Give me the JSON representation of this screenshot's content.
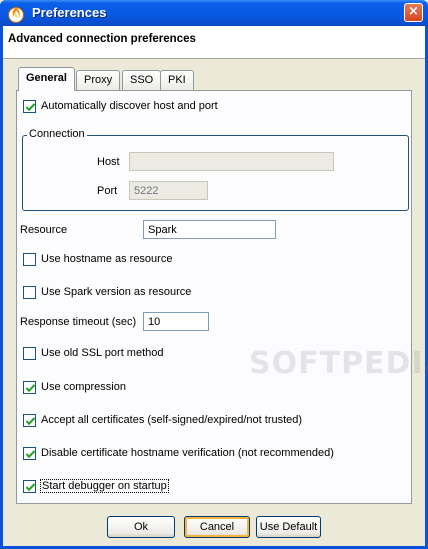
{
  "window": {
    "title": "Preferences",
    "icon": "flame-icon",
    "close_label": "×"
  },
  "header": {
    "title": "Advanced connection preferences"
  },
  "tabs": [
    {
      "label": "General",
      "active": true
    },
    {
      "label": "Proxy",
      "active": false
    },
    {
      "label": "SSO",
      "active": false
    },
    {
      "label": "PKI",
      "active": false
    }
  ],
  "general": {
    "auto_discover": {
      "label": "Automatically discover host and port",
      "checked": true
    },
    "connection": {
      "title": "Connection",
      "host_label": "Host",
      "host_value": "",
      "port_label": "Port",
      "port_placeholder": "5222"
    },
    "resource": {
      "label": "Resource",
      "value": "Spark"
    },
    "use_hostname": {
      "label": "Use hostname as resource",
      "checked": false
    },
    "use_spark_version": {
      "label": "Use Spark version as resource",
      "checked": false
    },
    "response_timeout": {
      "label": "Response timeout (sec)",
      "value": "10"
    },
    "old_ssl": {
      "label": "Use old SSL port method",
      "checked": false
    },
    "compression": {
      "label": "Use compression",
      "checked": true
    },
    "accept_certs": {
      "label": "Accept all certificates (self-signed/expired/not trusted)",
      "checked": true
    },
    "disable_hostname_verif": {
      "label": "Disable certificate hostname verification (not recommended)",
      "checked": true
    },
    "start_debugger": {
      "label": "Start debugger on startup",
      "checked": true
    }
  },
  "buttons": {
    "ok": "Ok",
    "cancel": "Cancel",
    "use_default": "Use Default"
  },
  "watermark": "SOFTPEDIA",
  "colors": {
    "title_bar": "#0a53d8",
    "window_bg": "#ece9d8",
    "panel_bg": "#fcfcfe",
    "default_button_ring": "#f3b53b"
  }
}
